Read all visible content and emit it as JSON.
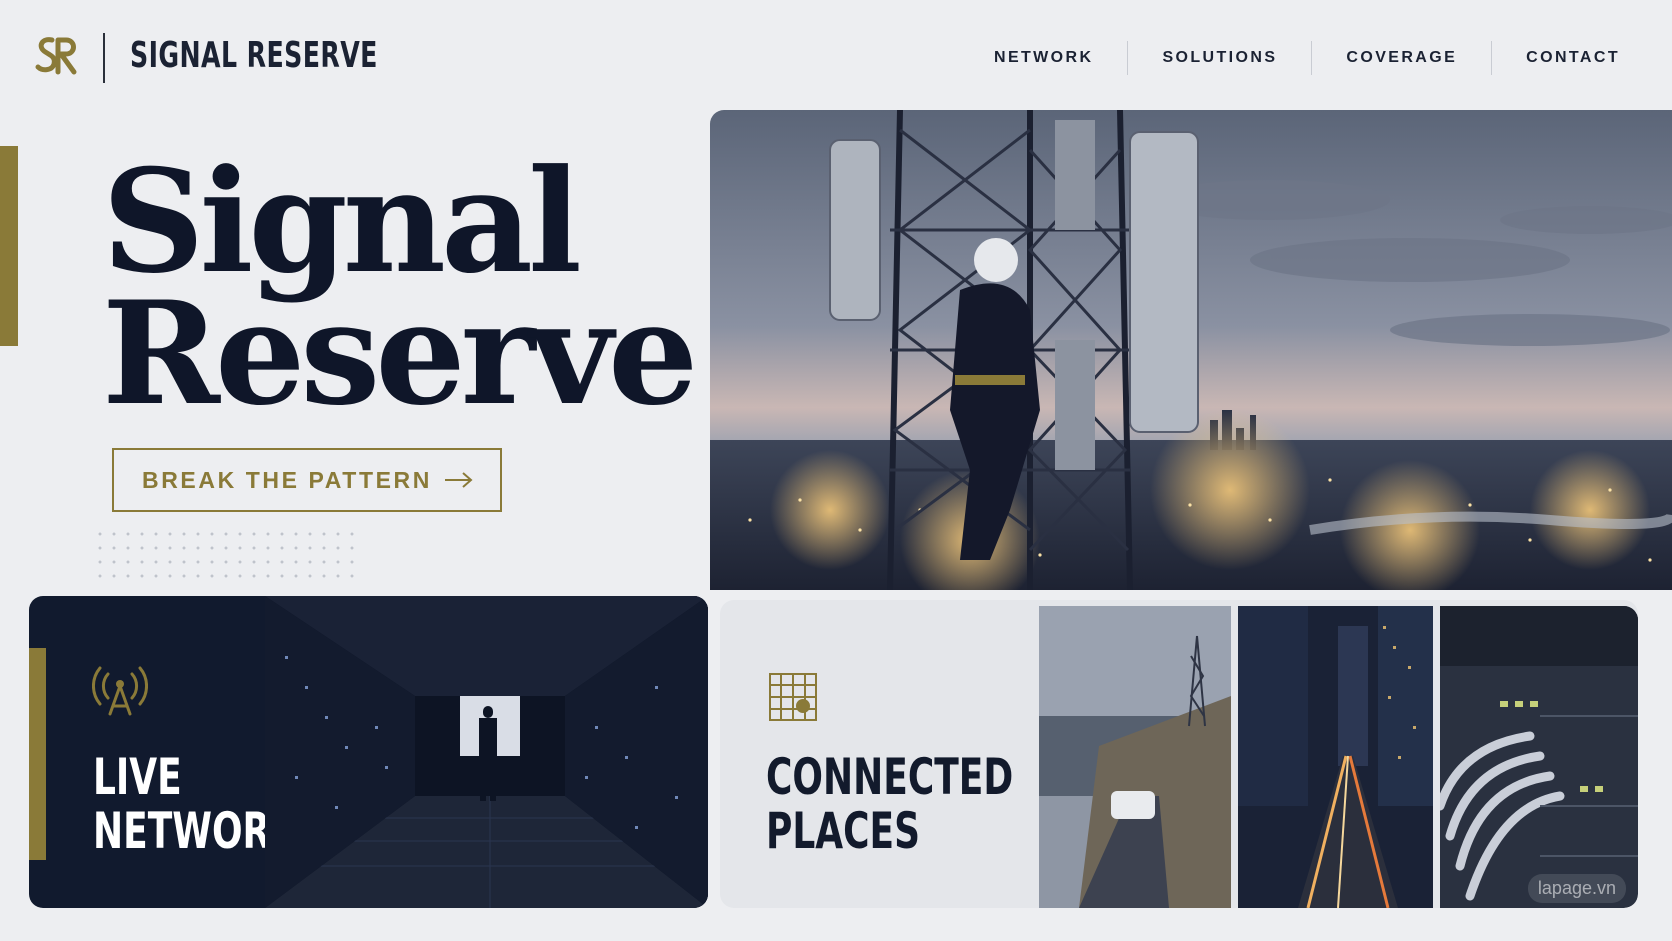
{
  "header": {
    "logo_text": "SR",
    "brand": "SIGNAL RESERVE",
    "nav": [
      {
        "label": "NETWORK"
      },
      {
        "label": "SOLUTIONS"
      },
      {
        "label": "COVERAGE"
      },
      {
        "label": "CONTACT"
      }
    ]
  },
  "hero": {
    "title_line1": "Signal",
    "title_line2": "Reserve",
    "cta_label": "BREAK THE PATTERN",
    "cta_icon": "arrow-right-icon",
    "image": "technician climbing cell tower above city at dusk"
  },
  "cards": {
    "live": {
      "icon": "antenna-broadcast-icon",
      "title_line1": "LIVE",
      "title_line2": "NETWORK",
      "image": "data center server corridor with silhouetted person"
    },
    "places": {
      "icon": "grid-map-pin-icon",
      "title_line1": "CONNECTED",
      "title_line2": "PLACES",
      "thumbnails": [
        "coastal road with cell tower and white SUV",
        "city street at night with light trails",
        "network switch with fiber cables"
      ]
    }
  },
  "watermark": "lapage.vn",
  "colors": {
    "accent_gold": "#8a7a38",
    "navy": "#111a2e",
    "background": "#edeef1"
  }
}
